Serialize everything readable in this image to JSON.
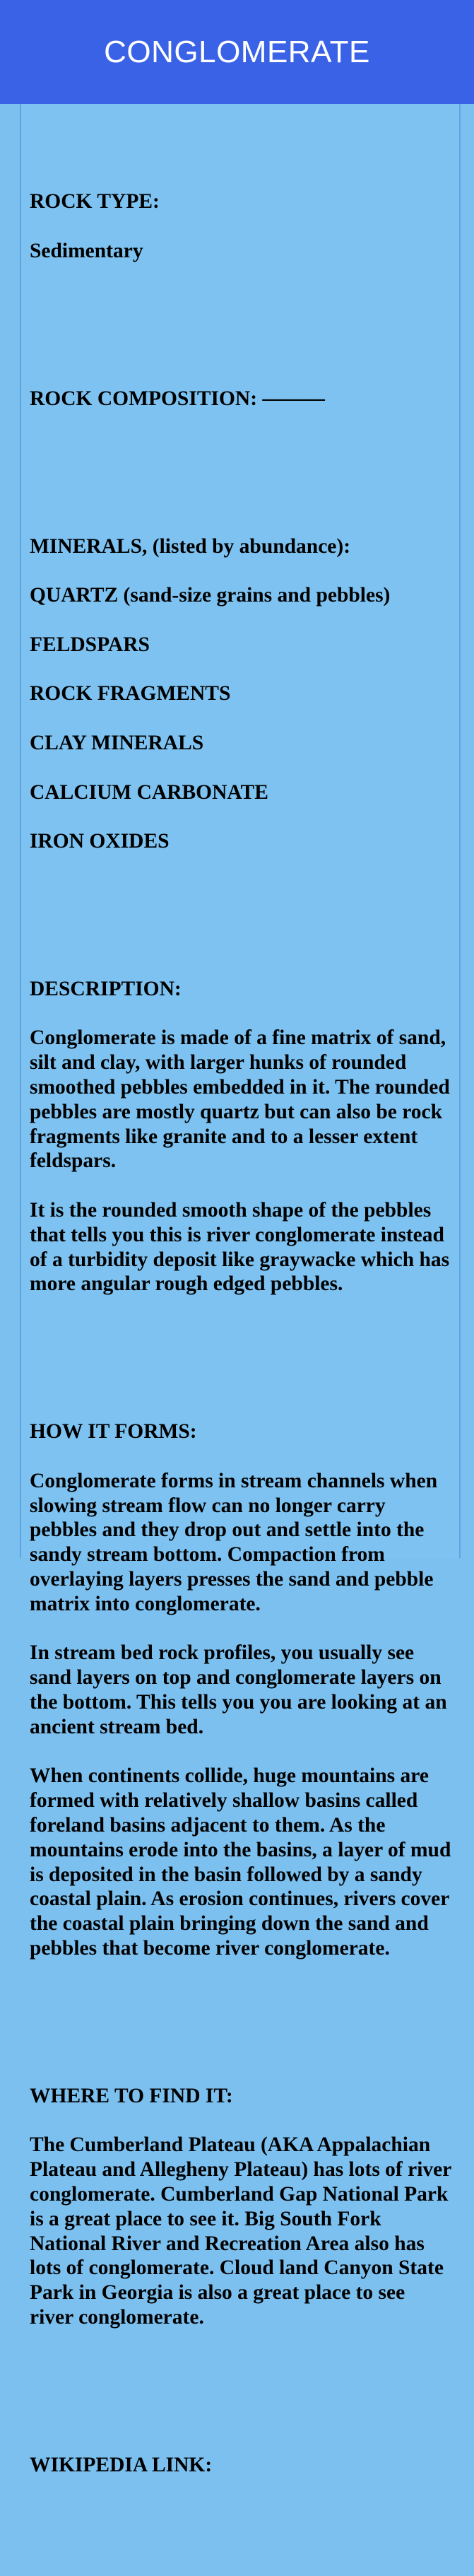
{
  "header": {
    "title": "CONGLOMERATE"
  },
  "sections": {
    "rock_type": {
      "label": "ROCK TYPE:",
      "value": "Sedimentary"
    },
    "rock_composition": {
      "label": "ROCK COMPOSITION: ———"
    },
    "minerals": {
      "label": "MINERALS, (listed by abundance):",
      "items": [
        "QUARTZ (sand-size grains and pebbles)",
        "FELDSPARS",
        "ROCK FRAGMENTS",
        "CLAY MINERALS",
        "CALCIUM CARBONATE",
        "IRON OXIDES"
      ]
    },
    "description": {
      "label": "DESCRIPTION:",
      "paragraphs": [
        "Conglomerate is made of a fine matrix of sand, silt and clay, with larger hunks of rounded smoothed pebbles embedded in it. The rounded pebbles are mostly quartz but can also be rock fragments like granite and to a lesser extent feldspars.",
        "It is the rounded smooth shape of the pebbles that tells you this is river conglomerate instead of a turbidity deposit like graywacke which has more angular rough edged pebbles."
      ]
    },
    "how_it_forms": {
      "label": "HOW IT FORMS:",
      "paragraphs": [
        "Conglomerate forms in stream channels when slowing stream flow can no longer carry pebbles and they drop out and settle into the sandy stream bottom. Compaction from overlaying layers presses the sand and pebble matrix into conglomerate.",
        "In stream bed rock profiles, you usually see sand layers on top and conglomerate layers on the bottom. This tells you you are looking at an ancient stream bed.",
        "When continents collide, huge mountains are formed with relatively shallow basins called foreland basins adjacent to them. As the mountains erode into the basins, a layer of mud is deposited in the basin followed by a sandy coastal plain. As erosion continues, rivers cover the coastal plain bringing down the sand and pebbles that become river conglomerate."
      ]
    },
    "where_to_find": {
      "label": "WHERE TO FIND IT:",
      "paragraphs": [
        "The Cumberland Plateau (AKA Appalachian Plateau and Allegheny Plateau) has lots of river conglomerate. Cumberland Gap National Park is a great place to see it. Big South Fork National River and Recreation Area also has lots of conglomerate.  Cloud land Canyon State Park in Georgia is also a great place to see river conglomerate."
      ]
    },
    "wikipedia": {
      "label": "WIKIPEDIA LINK:"
    }
  }
}
